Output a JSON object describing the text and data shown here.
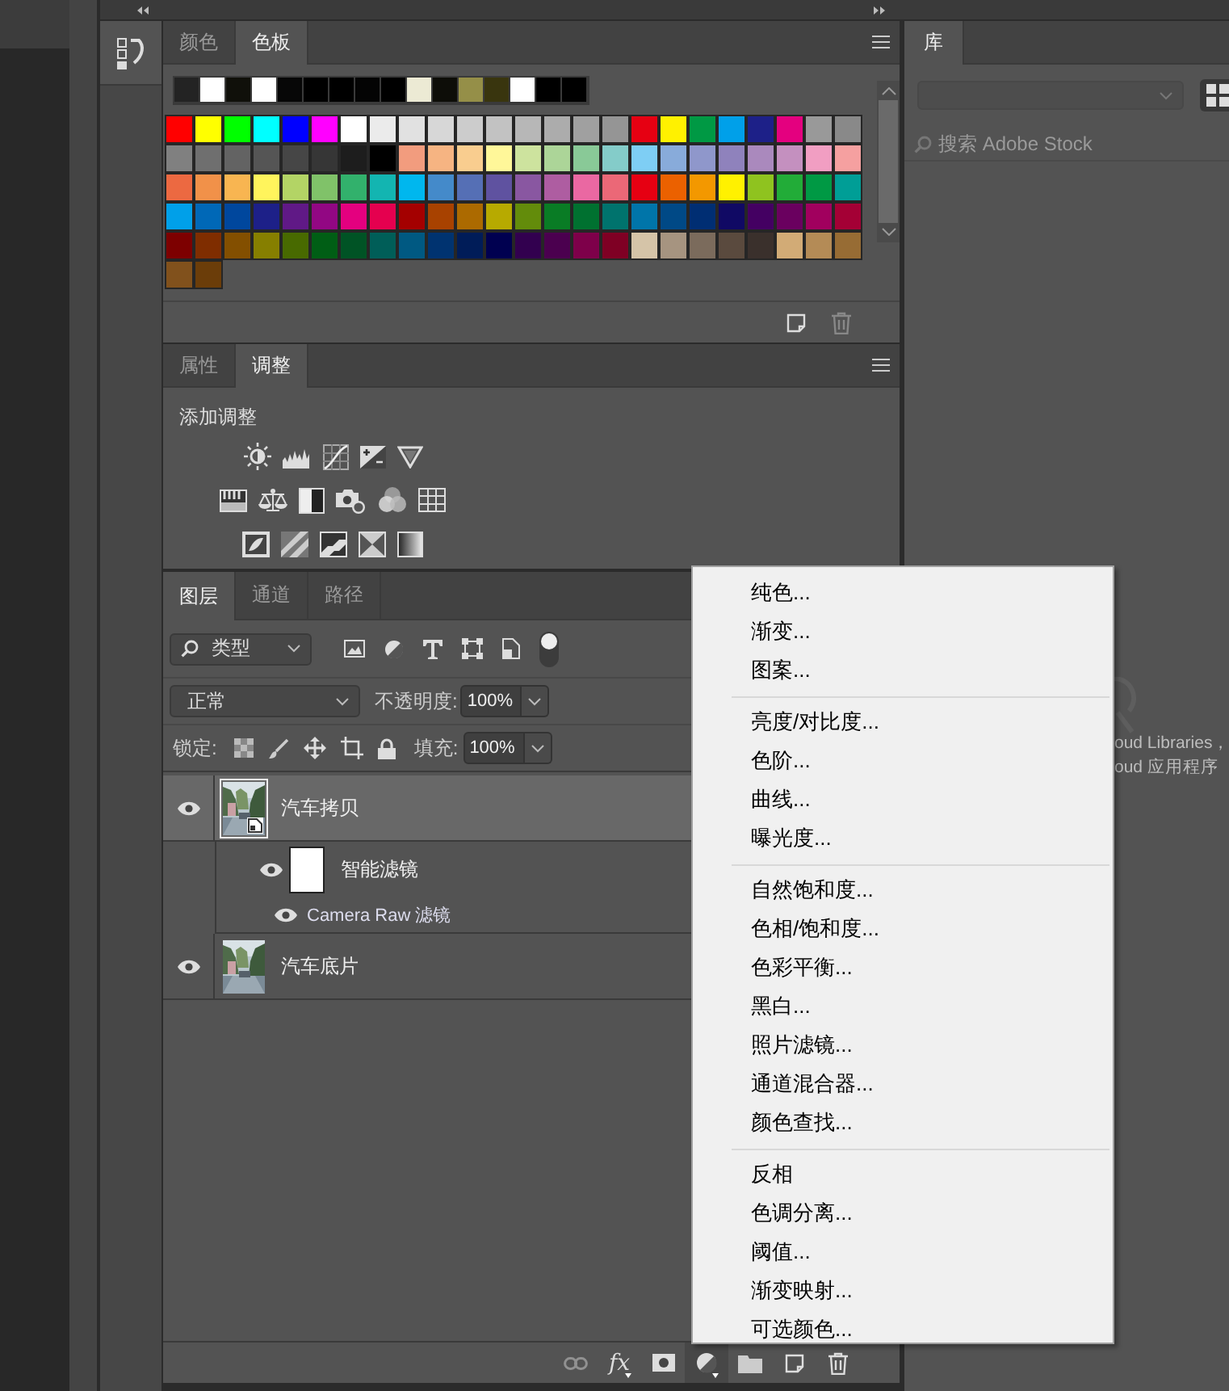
{
  "swatches_panel": {
    "tabs": [
      {
        "label": "颜色",
        "selected": false
      },
      {
        "label": "色板",
        "selected": true
      }
    ],
    "recent": [
      {
        "color": "#232323"
      },
      {
        "color": "#ffffff"
      },
      {
        "color": "#10100a"
      },
      {
        "color": "#ffffff"
      },
      {
        "color": "#070707"
      },
      {
        "color": "#000000"
      },
      {
        "color": "#000000"
      },
      {
        "color": "#040404"
      },
      {
        "color": "#000000"
      },
      {
        "color": "#ecead4"
      },
      {
        "color": "#0d0d08"
      },
      {
        "color": "#958f48"
      },
      {
        "color": "#39350e"
      },
      {
        "color": "#ffffff"
      },
      {
        "color": "#000000"
      },
      {
        "color": "#000000"
      }
    ],
    "swatches": [
      {
        "color": "#ff0000"
      },
      {
        "color": "#ffff00"
      },
      {
        "color": "#00ff00"
      },
      {
        "color": "#00ffff"
      },
      {
        "color": "#0000ff"
      },
      {
        "color": "#ff00ff"
      },
      {
        "color": "#ffffff"
      },
      {
        "color": "#ebebeb"
      },
      {
        "color": "#e1e1e1"
      },
      {
        "color": "#d7d7d7"
      },
      {
        "color": "#cccccc"
      },
      {
        "color": "#c2c2c2"
      },
      {
        "color": "#b7b7b7"
      },
      {
        "color": "#acacac"
      },
      {
        "color": "#a0a0a0"
      },
      {
        "color": "#959595"
      },
      {
        "color": "#e60012"
      },
      {
        "color": "#fff100"
      },
      {
        "color": "#009944"
      },
      {
        "color": "#00a0e9"
      },
      {
        "color": "#1d2088"
      },
      {
        "color": "#e4007f"
      },
      {
        "color": "#999999"
      },
      {
        "color": "#898989"
      },
      {
        "color": "#808080"
      },
      {
        "color": "#6f6f6f"
      },
      {
        "color": "#636363"
      },
      {
        "color": "#555555"
      },
      {
        "color": "#464646"
      },
      {
        "color": "#363636"
      },
      {
        "color": "#1d1d1d"
      },
      {
        "color": "#000000"
      },
      {
        "color": "#f29c7e"
      },
      {
        "color": "#f6b482"
      },
      {
        "color": "#f9cd8f"
      },
      {
        "color": "#fff799"
      },
      {
        "color": "#cde39e"
      },
      {
        "color": "#acd598"
      },
      {
        "color": "#89c997"
      },
      {
        "color": "#84ccc9"
      },
      {
        "color": "#7ecef4"
      },
      {
        "color": "#88abda"
      },
      {
        "color": "#8f97cb"
      },
      {
        "color": "#8f82bc"
      },
      {
        "color": "#aa89bd"
      },
      {
        "color": "#c490bf"
      },
      {
        "color": "#f19ec2"
      },
      {
        "color": "#f5a0a0"
      },
      {
        "color": "#ec6941"
      },
      {
        "color": "#f19149"
      },
      {
        "color": "#f8b551"
      },
      {
        "color": "#fff45c"
      },
      {
        "color": "#b3d465"
      },
      {
        "color": "#80c269"
      },
      {
        "color": "#32b16c"
      },
      {
        "color": "#13b5b1"
      },
      {
        "color": "#00b7ee"
      },
      {
        "color": "#448aca"
      },
      {
        "color": "#556fb5"
      },
      {
        "color": "#5f52a0"
      },
      {
        "color": "#8957a1"
      },
      {
        "color": "#ae5da1"
      },
      {
        "color": "#ea68a2"
      },
      {
        "color": "#eb6877"
      },
      {
        "color": "#e60012"
      },
      {
        "color": "#eb6100"
      },
      {
        "color": "#f39800"
      },
      {
        "color": "#fff100"
      },
      {
        "color": "#8fc31f"
      },
      {
        "color": "#22ac38"
      },
      {
        "color": "#009944"
      },
      {
        "color": "#009e96"
      },
      {
        "color": "#00a0e9"
      },
      {
        "color": "#0068b7"
      },
      {
        "color": "#00479d"
      },
      {
        "color": "#1d2088"
      },
      {
        "color": "#601986"
      },
      {
        "color": "#920783"
      },
      {
        "color": "#e4007f"
      },
      {
        "color": "#e5004f"
      },
      {
        "color": "#a40000"
      },
      {
        "color": "#a84200"
      },
      {
        "color": "#ac6a00"
      },
      {
        "color": "#b7aa00"
      },
      {
        "color": "#638c0b"
      },
      {
        "color": "#097c25"
      },
      {
        "color": "#007130"
      },
      {
        "color": "#00736d"
      },
      {
        "color": "#0075a9"
      },
      {
        "color": "#004986"
      },
      {
        "color": "#002e73"
      },
      {
        "color": "#100964"
      },
      {
        "color": "#440062"
      },
      {
        "color": "#6a005f"
      },
      {
        "color": "#a1005e"
      },
      {
        "color": "#a40035"
      },
      {
        "color": "#7d0000"
      },
      {
        "color": "#7f2d00"
      },
      {
        "color": "#834f00"
      },
      {
        "color": "#867f00"
      },
      {
        "color": "#486a00"
      },
      {
        "color": "#005e15"
      },
      {
        "color": "#005325"
      },
      {
        "color": "#005e58"
      },
      {
        "color": "#005982"
      },
      {
        "color": "#003370"
      },
      {
        "color": "#001c58"
      },
      {
        "color": "#000050"
      },
      {
        "color": "#32004f"
      },
      {
        "color": "#4b004f"
      },
      {
        "color": "#7e004a"
      },
      {
        "color": "#7f0024"
      },
      {
        "color": "#d5c4a8"
      },
      {
        "color": "#a69480"
      },
      {
        "color": "#7b6b5c"
      },
      {
        "color": "#5a4a3e"
      },
      {
        "color": "#3a302c"
      },
      {
        "color": "#d2ab76"
      },
      {
        "color": "#b48b56"
      },
      {
        "color": "#976c34"
      },
      {
        "color": "#81511c"
      },
      {
        "color": "#6b3d09"
      }
    ]
  },
  "adjustments_panel": {
    "tabs": [
      {
        "label": "属性",
        "selected": false
      },
      {
        "label": "调整",
        "selected": true
      }
    ],
    "heading": "添加调整"
  },
  "layers_panel": {
    "tabs": [
      {
        "label": "图层",
        "selected": true
      },
      {
        "label": "通道",
        "selected": false
      },
      {
        "label": "路径",
        "selected": false
      }
    ],
    "filter": {
      "value": "类型",
      "on": true
    },
    "blend_mode": "正常",
    "opacity_label": "不透明度:",
    "opacity": "100%",
    "lock_label": "锁定:",
    "fill_label": "填充:",
    "fill": "100%",
    "layers": [
      {
        "name": "汽车拷贝",
        "kind": "smart",
        "visible": true,
        "selected": true,
        "children": [
          {
            "name": "智能滤镜",
            "visible": true,
            "children": [
              {
                "name": "Camera Raw 滤镜",
                "visible": true
              }
            ]
          }
        ]
      },
      {
        "name": "汽车底片",
        "kind": "normal",
        "visible": true,
        "selected": false
      }
    ],
    "toolbar": [
      {
        "kind": "link",
        "disabled": true,
        "pressed": false
      },
      {
        "kind": "fx",
        "label": "fx",
        "disabled": false,
        "pressed": false
      },
      {
        "kind": "mask",
        "disabled": false,
        "pressed": false
      },
      {
        "kind": "adjustment",
        "disabled": false,
        "pressed": true
      },
      {
        "kind": "group",
        "disabled": false,
        "pressed": false
      },
      {
        "kind": "new",
        "disabled": false,
        "pressed": false
      },
      {
        "kind": "delete",
        "disabled": false,
        "pressed": false
      }
    ]
  },
  "library_panel": {
    "tabs": [
      {
        "label": "库",
        "selected": true
      }
    ],
    "search": {
      "placeholder": "搜索 Adobe Stock"
    },
    "message_lines": [
      "oud Libraries，",
      "oud 应用程序"
    ]
  },
  "menu": {
    "groups": [
      [
        "纯色...",
        "渐变...",
        "图案..."
      ],
      [
        "亮度/对比度...",
        "色阶...",
        "曲线...",
        "曝光度..."
      ],
      [
        "自然饱和度...",
        "色相/饱和度...",
        "色彩平衡...",
        "黑白...",
        "照片滤镜...",
        "通道混合器...",
        "颜色查找..."
      ],
      [
        "反相",
        "色调分离...",
        "阈值...",
        "渐变映射...",
        "可选颜色..."
      ]
    ]
  }
}
